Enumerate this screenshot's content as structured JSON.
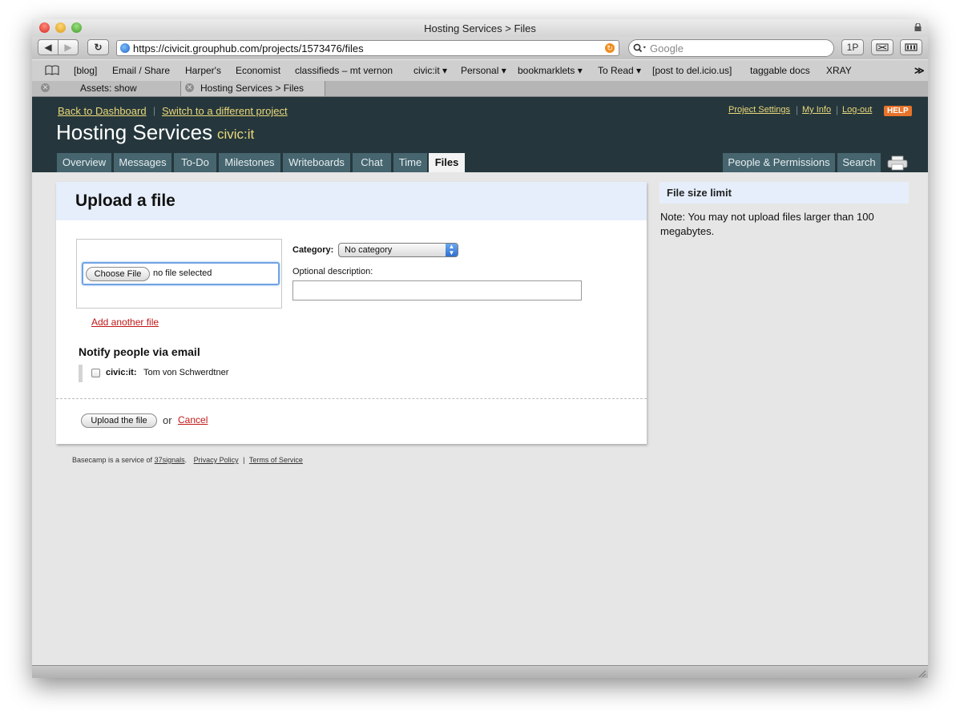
{
  "browser": {
    "window_title": "Hosting Services > Files",
    "url": "https://civicit.grouphub.com/projects/1573476/files",
    "search_placeholder": "Google",
    "onepassword_label": "1P",
    "bookmarks": [
      "[blog]",
      "Email / Share",
      "Harper's",
      "Economist",
      "classifieds – mt vernon",
      "civic:it ▾",
      "Personal ▾",
      "bookmarklets ▾",
      "To Read ▾",
      "[post to del.icio.us]",
      "taggable docs",
      "XRAY"
    ],
    "overflow_label": "≫",
    "tabs": [
      {
        "label": "Assets: show"
      },
      {
        "label": "Hosting Services > Files"
      }
    ]
  },
  "header": {
    "back_link": "Back to Dashboard",
    "switch_link": "Switch to a different project",
    "separator": "|",
    "project_settings": "Project Settings",
    "my_info": "My Info",
    "logout": "Log-out",
    "help": "HELP",
    "project_title": "Hosting Services",
    "company": "civic:it",
    "nav_tabs": [
      "Overview",
      "Messages",
      "To-Do",
      "Milestones",
      "Writeboards",
      "Chat",
      "Time",
      "Files"
    ],
    "active_tab": "Files",
    "right_tabs": [
      "People & Permissions",
      "Search"
    ]
  },
  "upload": {
    "title": "Upload a file",
    "choose_file": "Choose File",
    "no_file": "no file selected",
    "add_another": "Add another file",
    "category_label": "Category:",
    "category_value": "No category",
    "description_label": "Optional description:",
    "description_value": "",
    "notify_title": "Notify people via email",
    "notify_people": [
      {
        "org": "civic:it:",
        "name": "Tom von Schwerdtner",
        "checked": false
      }
    ],
    "submit_label": "Upload the file",
    "or_text": "or",
    "cancel_label": "Cancel"
  },
  "sidebar": {
    "title": "File size limit",
    "note": "Note: You may not upload files larger than 100 megabytes."
  },
  "footer": {
    "text": "Basecamp is a service of",
    "company_link": "37signals",
    "privacy": "Privacy Policy",
    "terms": "Terms of Service",
    "period": ".",
    "separator": "|"
  },
  "colors": {
    "header_bg": "#25373c",
    "tab_bg": "#46656f",
    "link_yellow": "#ecd87a",
    "link_red": "#c01818",
    "panel_head_bg": "#e6eefb"
  }
}
